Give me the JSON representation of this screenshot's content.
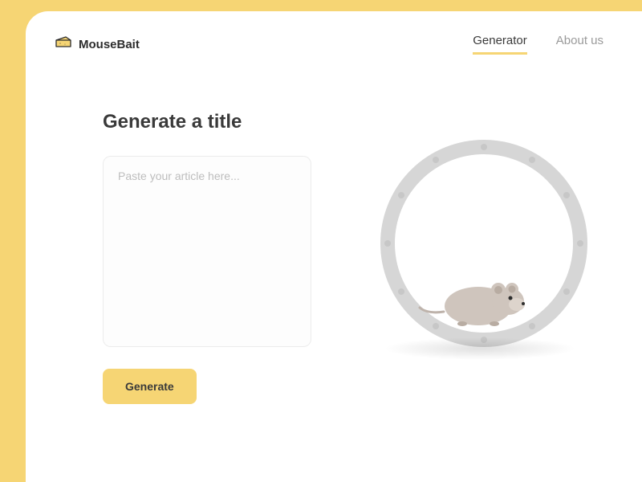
{
  "brand": {
    "name": "MouseBait"
  },
  "nav": {
    "items": [
      {
        "label": "Generator",
        "active": true
      },
      {
        "label": "About us",
        "active": false
      }
    ]
  },
  "main": {
    "heading": "Generate a title",
    "textarea_placeholder": "Paste your article here...",
    "button_label": "Generate"
  },
  "colors": {
    "accent": "#f6d574",
    "text_dark": "#3a3a3a",
    "text_muted": "#9a9a9a"
  }
}
